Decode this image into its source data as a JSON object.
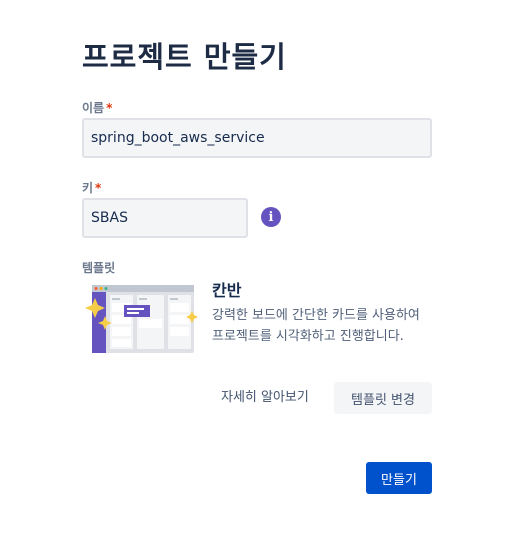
{
  "page": {
    "title": "프로젝트 만들기"
  },
  "form": {
    "name": {
      "label": "이름",
      "required_mark": "*",
      "value": "spring_boot_aws_service"
    },
    "key": {
      "label": "키",
      "required_mark": "*",
      "value": "SBAS",
      "info_icon": "info-icon"
    },
    "template": {
      "label": "템플릿",
      "name": "칸반",
      "description": "강력한 보드에 간단한 카드를 사용하여 프로젝트를 시각화하고 진행합니다.",
      "learn_more": "자세히 알아보기",
      "change_button": "템플릿 변경"
    }
  },
  "footer": {
    "create_button": "만들기"
  },
  "colors": {
    "primary": "#0052cc",
    "info": "#6554c0",
    "required": "#de350b",
    "accent_star": "#f5cd47"
  }
}
